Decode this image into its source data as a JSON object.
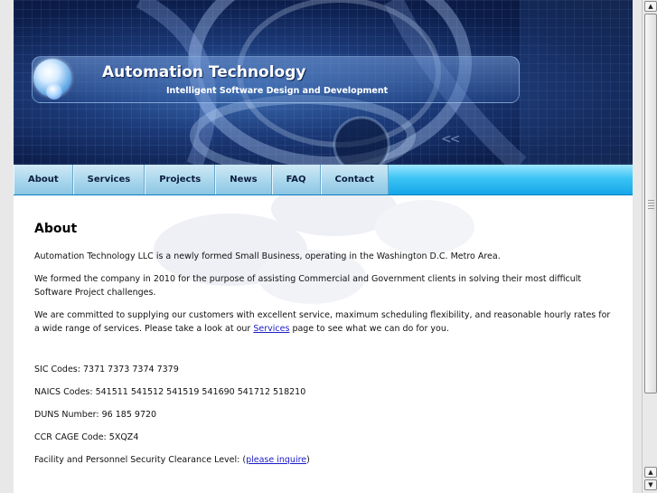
{
  "site": {
    "title": "Automation Technology",
    "tagline": "Intelligent Software Design and Development",
    "chevrons": "<<"
  },
  "nav": {
    "items": [
      {
        "label": "About"
      },
      {
        "label": "Services"
      },
      {
        "label": "Projects"
      },
      {
        "label": "News"
      },
      {
        "label": "FAQ"
      },
      {
        "label": "Contact"
      }
    ]
  },
  "content": {
    "heading": "About",
    "p1": "Automation Technology LLC is a newly formed Small Business, operating in the Washington D.C. Metro Area.",
    "p2": "We formed the company in 2010 for the purpose of assisting Commercial and Government clients in solving their most difficult Software Project challenges.",
    "p3_before": "We are committed to supplying our customers with excellent service, maximum scheduling flexibility, and reasonable hourly rates for a wide range of services.  Please take a look at our ",
    "p3_link": "Services",
    "p3_after": " page to see what we can do for you.",
    "sic": "SIC Codes:  7371   7373   7374   7379",
    "naics": "NAICS Codes:  541511   541512   541519   541690   541712   518210",
    "duns": "DUNS Number:  96 185 9720",
    "cage": "CCR CAGE Code:  5XQZ4",
    "clearance_before": "Facility and Personnel Security Clearance Level:  (",
    "clearance_link": "please inquire",
    "clearance_after": ")"
  },
  "scrollbar": {
    "up_icon": "▲",
    "down_icon": "▼",
    "up2_icon": "▲",
    "down2_icon": "▼"
  },
  "colors": {
    "nav_accent": "#16a6e8",
    "link": "#1c1cc8",
    "banner_dark": "#0c1d4a"
  }
}
